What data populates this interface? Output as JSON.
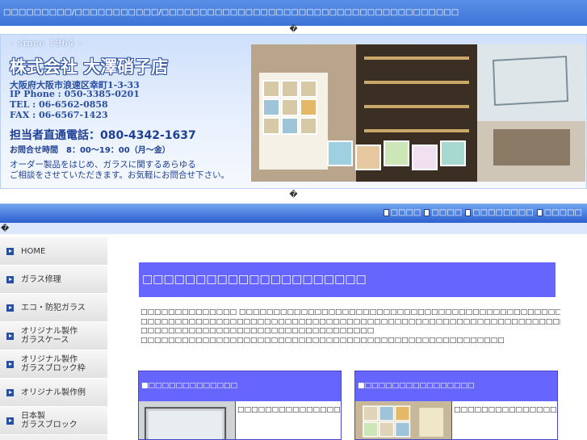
{
  "topbar": {
    "text": "□□□□□□□□□/□□□□□□□□□□□/□□□□□□□□□□□□□□□□□□□□□□□□□□□□□□□□□□□□□□□"
  },
  "marks": {
    "top": "�",
    "mid": "�",
    "left": "�"
  },
  "header": {
    "since": "- since 1964 -",
    "company": "株式会社 大澤硝子店",
    "address": "大阪府大阪市浪速区幸町1-3-33",
    "ip_phone": "IP Phone : 050-3385-0201",
    "tel": "TEL : 06-6562-0858",
    "fax": "FAX : 06-6567-1423",
    "direct": "担当者直通電話：080-4342-1637",
    "hours": "お問合せ時間　8：00〜19：00（月〜金）",
    "desc1": "オーダー製品をはじめ、ガラスに関するあらゆる",
    "desc2": "ご相談をさせていただきます。お気軽にお問合せ下さい。"
  },
  "nav": {
    "items": [
      "□□□□",
      "□□□□",
      "□□□□□□□□",
      "□□□□□"
    ]
  },
  "sidebar": {
    "items": [
      "HOME",
      "ガラス修理",
      "エコ・防犯ガラス",
      "オリジナル製作\nガラスケース",
      "オリジナル製作\nガラスブロック枠",
      "オリジナル製作例",
      "日本製\nガラスブロック"
    ]
  },
  "main": {
    "title": "□□□□□□□□□□□□□□□□□□□□□",
    "intro": [
      "□□□□□□□□□□□□□□ □□□□□□□□□□□□□□□□□□□□□□□□□□□□□□□□□□□□□□□□□□□□□□□□□□□□□□□□□□□□□□□□□□□□□□□□□□□□□□□",
      "□□□□□□□□□□□□□□□□□□□□□□□□□□□□□□□□□□□□□□□□□□□□□□□□□□□□□□□□□□□□□□□□□□□□□□□□□□",
      "□□□□□□□□□□□□□□□□□□□□□□□□□□□□□□□□□□",
      "□□□□□□□□□□□□□□□□□□□□□□□□□□□□□□□□□□□□□□□□□□□□□□□□□□□□□"
    ],
    "box1": {
      "head": "■□□□□□□□□□□□□□",
      "text": "□□□□□□□□□□□□□□□□□□□□□□□□□□□□□□□□□□□□□"
    },
    "box2": {
      "head": "■□□□□□□□□□□□□□□□□",
      "text": "□□□□□□□□□□□□□□□□□□□□□□□□□□□□□□□□□□□□□"
    }
  },
  "colors": {
    "accent": "#6666ff",
    "nav": "#2d5fcf",
    "brand": "#1e3f94"
  }
}
